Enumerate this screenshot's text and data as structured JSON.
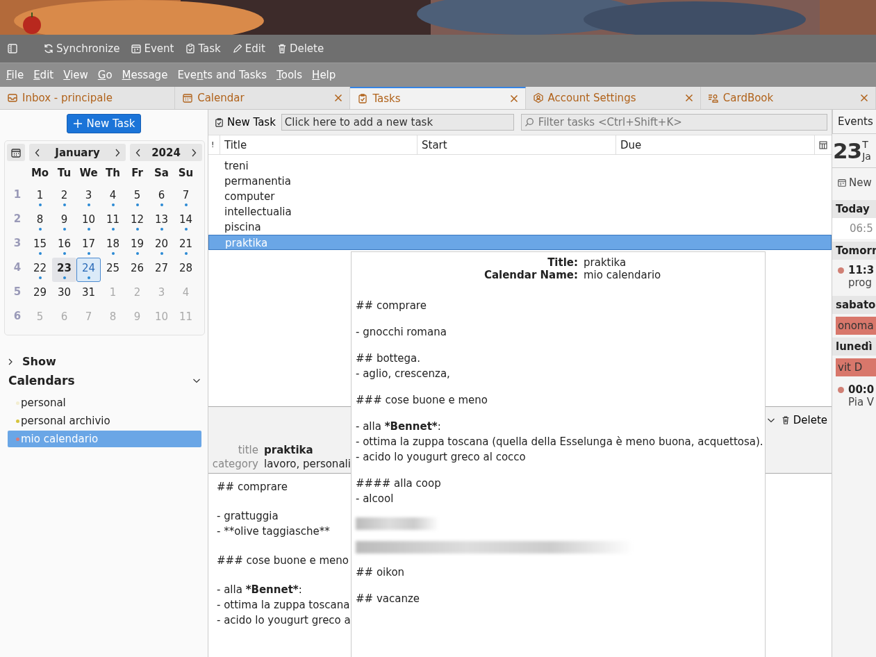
{
  "toolbar": [
    {
      "kind": "sidebar"
    },
    {
      "kind": "sync",
      "label": "Synchronize"
    },
    {
      "kind": "event",
      "label": "Event"
    },
    {
      "kind": "task",
      "label": "Task"
    },
    {
      "kind": "edit",
      "label": "Edit"
    },
    {
      "kind": "delete",
      "label": "Delete"
    }
  ],
  "menubar": [
    {
      "key": "F",
      "after": "ile"
    },
    {
      "key": "E",
      "after": "dit"
    },
    {
      "key": "V",
      "after": "iew"
    },
    {
      "key": "G",
      "after": "o"
    },
    {
      "key": "M",
      "after": "essage"
    },
    {
      "before": "Eve",
      "key": "n",
      "after": "ts and Tasks"
    },
    {
      "key": "T",
      "after": "ools"
    },
    {
      "key": "H",
      "after": "elp"
    }
  ],
  "tabs": [
    {
      "kind": "inbox",
      "label": "Inbox - principale",
      "closable": false,
      "selected": false
    },
    {
      "kind": "calendar",
      "label": "Calendar",
      "closable": true,
      "selected": false
    },
    {
      "kind": "task",
      "label": "Tasks",
      "closable": true,
      "selected": true
    },
    {
      "kind": "account",
      "label": "Account Settings",
      "closable": true,
      "selected": false
    },
    {
      "kind": "contacts",
      "label": "CardBook",
      "closable": true,
      "selected": false
    }
  ],
  "sidebar": {
    "new_task": "New Task",
    "minimonth": {
      "month": "January",
      "year": "2024",
      "weekdays": [
        "Mo",
        "Tu",
        "We",
        "Th",
        "Fr",
        "Sa",
        "Su"
      ],
      "weeks": [
        {
          "number": "1",
          "days": [
            {
              "d": "1",
              "ev": true,
              "kind": "current",
              "selected": false
            },
            {
              "d": "2",
              "ev": true,
              "kind": "current",
              "selected": false
            },
            {
              "d": "3",
              "ev": true,
              "kind": "current",
              "selected": false
            },
            {
              "d": "4",
              "ev": true,
              "kind": "current",
              "selected": false
            },
            {
              "d": "5",
              "ev": true,
              "kind": "current",
              "selected": false
            },
            {
              "d": "6",
              "ev": true,
              "kind": "current",
              "selected": false
            },
            {
              "d": "7",
              "ev": true,
              "kind": "current",
              "selected": false
            }
          ]
        },
        {
          "number": "2",
          "days": [
            {
              "d": "8",
              "ev": true,
              "kind": "current",
              "selected": false
            },
            {
              "d": "9",
              "ev": true,
              "kind": "current",
              "selected": false
            },
            {
              "d": "10",
              "ev": true,
              "kind": "current",
              "selected": false
            },
            {
              "d": "11",
              "ev": true,
              "kind": "current",
              "selected": false
            },
            {
              "d": "12",
              "ev": true,
              "kind": "current",
              "selected": false
            },
            {
              "d": "13",
              "ev": true,
              "kind": "current",
              "selected": false
            },
            {
              "d": "14",
              "ev": true,
              "kind": "current",
              "selected": false
            }
          ]
        },
        {
          "number": "3",
          "days": [
            {
              "d": "15",
              "ev": true,
              "kind": "current",
              "selected": false
            },
            {
              "d": "16",
              "ev": true,
              "kind": "current",
              "selected": false
            },
            {
              "d": "17",
              "ev": true,
              "kind": "current",
              "selected": false
            },
            {
              "d": "18",
              "ev": true,
              "kind": "current",
              "selected": false
            },
            {
              "d": "19",
              "ev": true,
              "kind": "current",
              "selected": false
            },
            {
              "d": "20",
              "ev": true,
              "kind": "current",
              "selected": false
            },
            {
              "d": "21",
              "ev": true,
              "kind": "current",
              "selected": false
            }
          ]
        },
        {
          "number": "4",
          "days": [
            {
              "d": "22",
              "ev": true,
              "kind": "current",
              "selected": false
            },
            {
              "d": "23",
              "ev": true,
              "kind": "today",
              "selected": false
            },
            {
              "d": "24",
              "ev": true,
              "kind": "current",
              "selected": true
            },
            {
              "d": "25",
              "ev": false,
              "kind": "current",
              "selected": false
            },
            {
              "d": "26",
              "ev": false,
              "kind": "current",
              "selected": false
            },
            {
              "d": "27",
              "ev": false,
              "kind": "current",
              "selected": false
            },
            {
              "d": "28",
              "ev": false,
              "kind": "current",
              "selected": false
            }
          ]
        },
        {
          "number": "5",
          "days": [
            {
              "d": "29",
              "ev": false,
              "kind": "current",
              "selected": false
            },
            {
              "d": "30",
              "ev": false,
              "kind": "current",
              "selected": false
            },
            {
              "d": "31",
              "ev": false,
              "kind": "current",
              "selected": false
            },
            {
              "d": "1",
              "ev": false,
              "kind": "other",
              "selected": false
            },
            {
              "d": "2",
              "ev": false,
              "kind": "other",
              "selected": false
            },
            {
              "d": "3",
              "ev": false,
              "kind": "other",
              "selected": false
            },
            {
              "d": "4",
              "ev": false,
              "kind": "other",
              "selected": false
            }
          ]
        },
        {
          "number": "6",
          "days": [
            {
              "d": "5",
              "ev": false,
              "kind": "other",
              "selected": false
            },
            {
              "d": "6",
              "ev": false,
              "kind": "other",
              "selected": false
            },
            {
              "d": "7",
              "ev": false,
              "kind": "other",
              "selected": false
            },
            {
              "d": "8",
              "ev": false,
              "kind": "other",
              "selected": false
            },
            {
              "d": "9",
              "ev": false,
              "kind": "other",
              "selected": false
            },
            {
              "d": "10",
              "ev": false,
              "kind": "other",
              "selected": false
            },
            {
              "d": "11",
              "ev": false,
              "kind": "other",
              "selected": false
            }
          ]
        }
      ]
    },
    "show": {
      "label": "Show",
      "expanded": false
    },
    "calendars": {
      "label": "Calendars",
      "expanded": true,
      "items": [
        {
          "name": "personal",
          "color": "#f3eed2",
          "selected": false
        },
        {
          "name": "personal archivio",
          "color": "#d6c43c",
          "selected": false
        },
        {
          "name": "mio calendario",
          "color": "#d67a7a",
          "selected": true
        }
      ]
    }
  },
  "task_toolbar": {
    "new_task": "New Task",
    "quick_add": {
      "placeholder": "Click here to add a new task"
    },
    "filter": {
      "placeholder": "Filter tasks <Ctrl+Shift+K>"
    }
  },
  "table": {
    "columns": [
      "!",
      "Title",
      "Start",
      "Due"
    ],
    "rows": [
      {
        "title": "treni",
        "selected": false
      },
      {
        "title": "permanentia",
        "selected": false
      },
      {
        "title": "computer",
        "selected": false
      },
      {
        "title": "intellectualia",
        "selected": false
      },
      {
        "title": "piscina",
        "selected": false
      },
      {
        "title": "praktika",
        "selected": true
      }
    ]
  },
  "details": {
    "fields": [
      {
        "label": "title",
        "value": "praktika",
        "kind": "title"
      },
      {
        "label": "category",
        "value": "lavoro, personali",
        "kind": "plain"
      }
    ],
    "delete": "Delete",
    "description": [
      [
        "## comprare"
      ],
      [
        "- grattuggia",
        "- **olive taggiasche**"
      ],
      [
        "### cose buone e meno"
      ],
      [
        {
          "parts": [
            {
              "text": "- alla ",
              "bold": false
            },
            {
              "text": "*Bennet*",
              "bold": true
            },
            {
              "text": ":",
              "bold": false
            }
          ]
        },
        "- ottima la zuppa toscana",
        "- acido lo yougurt greco a"
      ]
    ]
  },
  "tooltip": {
    "fields": [
      {
        "label": "Title:",
        "value": "praktika"
      },
      {
        "label": "Calendar Name:",
        "value": "mio calendario"
      }
    ],
    "blocks": [
      [
        "## comprare"
      ],
      [
        "- gnocchi romana"
      ],
      [
        "## bottega.",
        "- aglio, crescenza,"
      ],
      [
        "### cose buone e meno"
      ],
      [
        {
          "parts": [
            {
              "text": "- alla ",
              "bold": false
            },
            {
              "text": "*Bennet*",
              "bold": true
            },
            {
              "text": ":",
              "bold": false
            }
          ]
        },
        "- ottima la zuppa toscana (quella della Esselunga è meno buona, acquettosa).",
        "- acido lo yougurt greco al cocco"
      ],
      [
        "#### alla coop",
        "- alcool"
      ],
      [
        {
          "kind": "blurred"
        }
      ],
      [
        {
          "kind": "blurred"
        }
      ],
      [
        "## oikon"
      ],
      [
        "## vacanze"
      ]
    ]
  },
  "today_pane": {
    "tab": "Events",
    "day": "23",
    "weekday": "T",
    "month": "Ja",
    "new": "New",
    "groups": [
      {
        "heading": "Today",
        "items": [
          {
            "kind": "time",
            "time": "06:5"
          }
        ]
      },
      {
        "heading": "Tomorr",
        "items": [
          {
            "kind": "timed",
            "time": "11:3",
            "title": "prog",
            "dot": true
          }
        ]
      },
      {
        "heading": "sabato",
        "items": [
          {
            "kind": "allday",
            "title": "onoma"
          }
        ]
      },
      {
        "heading": "lunedì",
        "items": [
          {
            "kind": "allday",
            "title": "vit D"
          },
          {
            "kind": "timed",
            "time": "00:0",
            "title": "Pia V",
            "dot": true
          }
        ]
      }
    ]
  }
}
